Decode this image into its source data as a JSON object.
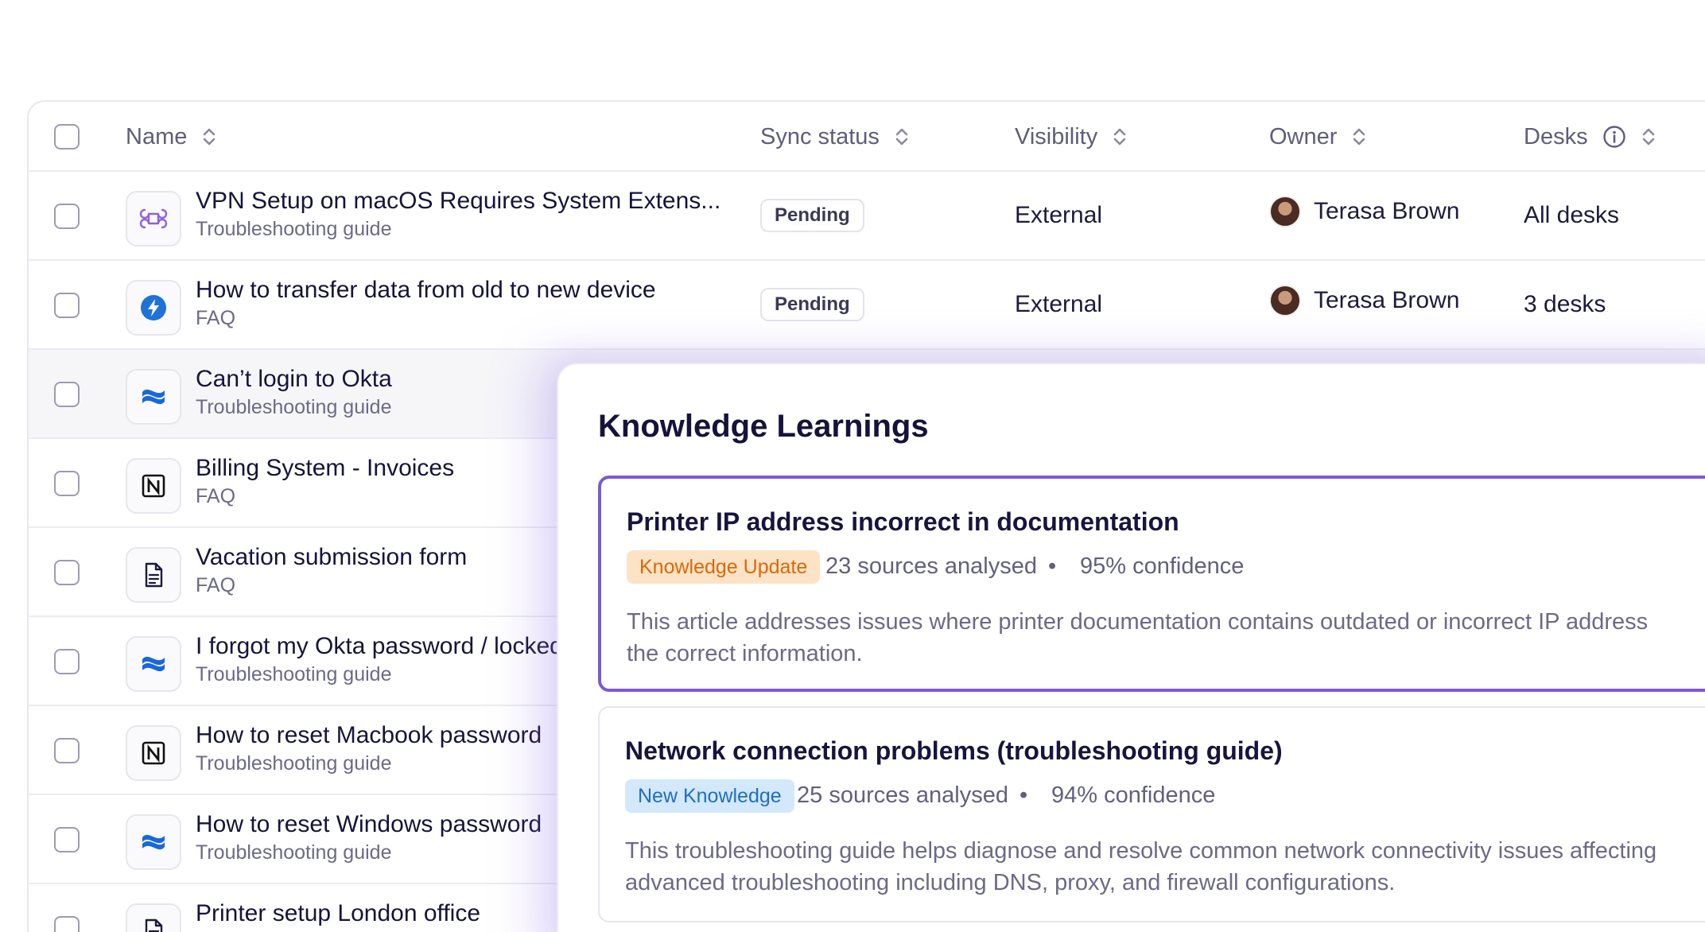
{
  "table": {
    "columns": {
      "name": "Name",
      "sync_status": "Sync status",
      "visibility": "Visibility",
      "owner": "Owner",
      "desks": "Desks"
    },
    "rows": [
      {
        "title": "VPN Setup on macOS Requires System Extens...",
        "type": "Troubleshooting guide",
        "icon": "command-icon",
        "status": "Pending",
        "visibility": "External",
        "owner": "Terasa Brown",
        "desks": "All desks"
      },
      {
        "title": "How to transfer data from old to new device",
        "type": "FAQ",
        "icon": "zendesk-icon",
        "status": "Pending",
        "visibility": "External",
        "owner": "Terasa Brown",
        "desks": "3 desks"
      },
      {
        "title": "Can’t login to Okta",
        "type": "Troubleshooting guide",
        "icon": "confluence-icon"
      },
      {
        "title": "Billing System - Invoices",
        "type": "FAQ",
        "icon": "notion-icon"
      },
      {
        "title": "Vacation submission form",
        "type": "FAQ",
        "icon": "document-icon"
      },
      {
        "title": "I forgot my Okta password / locked",
        "type": "Troubleshooting guide",
        "icon": "confluence-icon"
      },
      {
        "title": "How to reset Macbook password",
        "type": "Troubleshooting guide",
        "icon": "notion-icon"
      },
      {
        "title": "How to reset Windows password",
        "type": "Troubleshooting guide",
        "icon": "confluence-icon"
      },
      {
        "title": "Printer setup London office",
        "type": "",
        "icon": "document-icon"
      }
    ]
  },
  "panel": {
    "title": "Knowledge Learnings",
    "cards": [
      {
        "title": "Printer IP address incorrect in documentation",
        "tag": "Knowledge Update",
        "sources": "23 sources analysed",
        "separator": "•",
        "confidence": "95% confidence",
        "desc_line1": "This article addresses issues where printer documentation contains outdated or incorrect IP address",
        "desc_line2": "the correct information."
      },
      {
        "title": "Network connection problems (troubleshooting guide)",
        "tag": "New Knowledge",
        "sources": "25 sources analysed",
        "separator": "•",
        "confidence": "94% confidence",
        "desc_line1": "This troubleshooting guide helps diagnose and resolve common network connectivity issues affecting",
        "desc_line2": "advanced troubleshooting including DNS, proxy, and firewall configurations."
      }
    ]
  },
  "colors": {
    "accent": "#7a5ad6",
    "tag_orange_bg": "#fde3c6",
    "tag_orange_text": "#d8690b",
    "tag_blue_bg": "#d3e8fb",
    "tag_blue_text": "#1e6fc1",
    "confluence_blue": "#1868db",
    "zendesk_blue": "#1f73d6"
  }
}
